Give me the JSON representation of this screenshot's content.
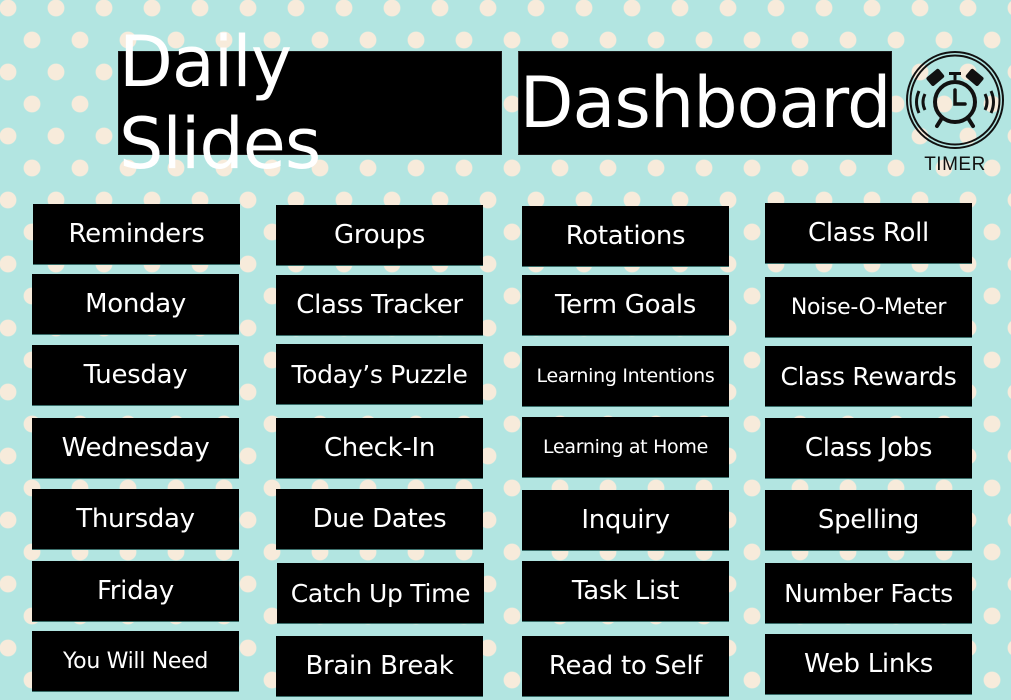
{
  "header": {
    "title_part1": "Daily Slides",
    "title_part2": "Dashboard"
  },
  "timer": {
    "icon": "alarm-clock-icon",
    "label": "TIMER"
  },
  "colors": {
    "background": "#b2e5e1",
    "dots": "#f7ebdb",
    "button_bg": "#000000",
    "button_text": "#ffffff"
  },
  "columns": [
    {
      "items": [
        "Reminders",
        "Monday",
        "Tuesday",
        "Wednesday",
        "Thursday",
        "Friday",
        "You Will Need"
      ]
    },
    {
      "items": [
        "Groups",
        "Class Tracker",
        "Today’s Puzzle",
        "Check-In",
        "Due Dates",
        "Catch Up Time",
        "Brain Break"
      ]
    },
    {
      "items": [
        "Rotations",
        "Term Goals",
        "Learning Intentions",
        "Learning at Home",
        "Inquiry",
        "Task List",
        "Read to Self"
      ]
    },
    {
      "items": [
        "Class Roll",
        "Noise-O-Meter",
        "Class Rewards",
        "Class Jobs",
        "Spelling",
        "Number Facts",
        "Web Links"
      ]
    }
  ]
}
